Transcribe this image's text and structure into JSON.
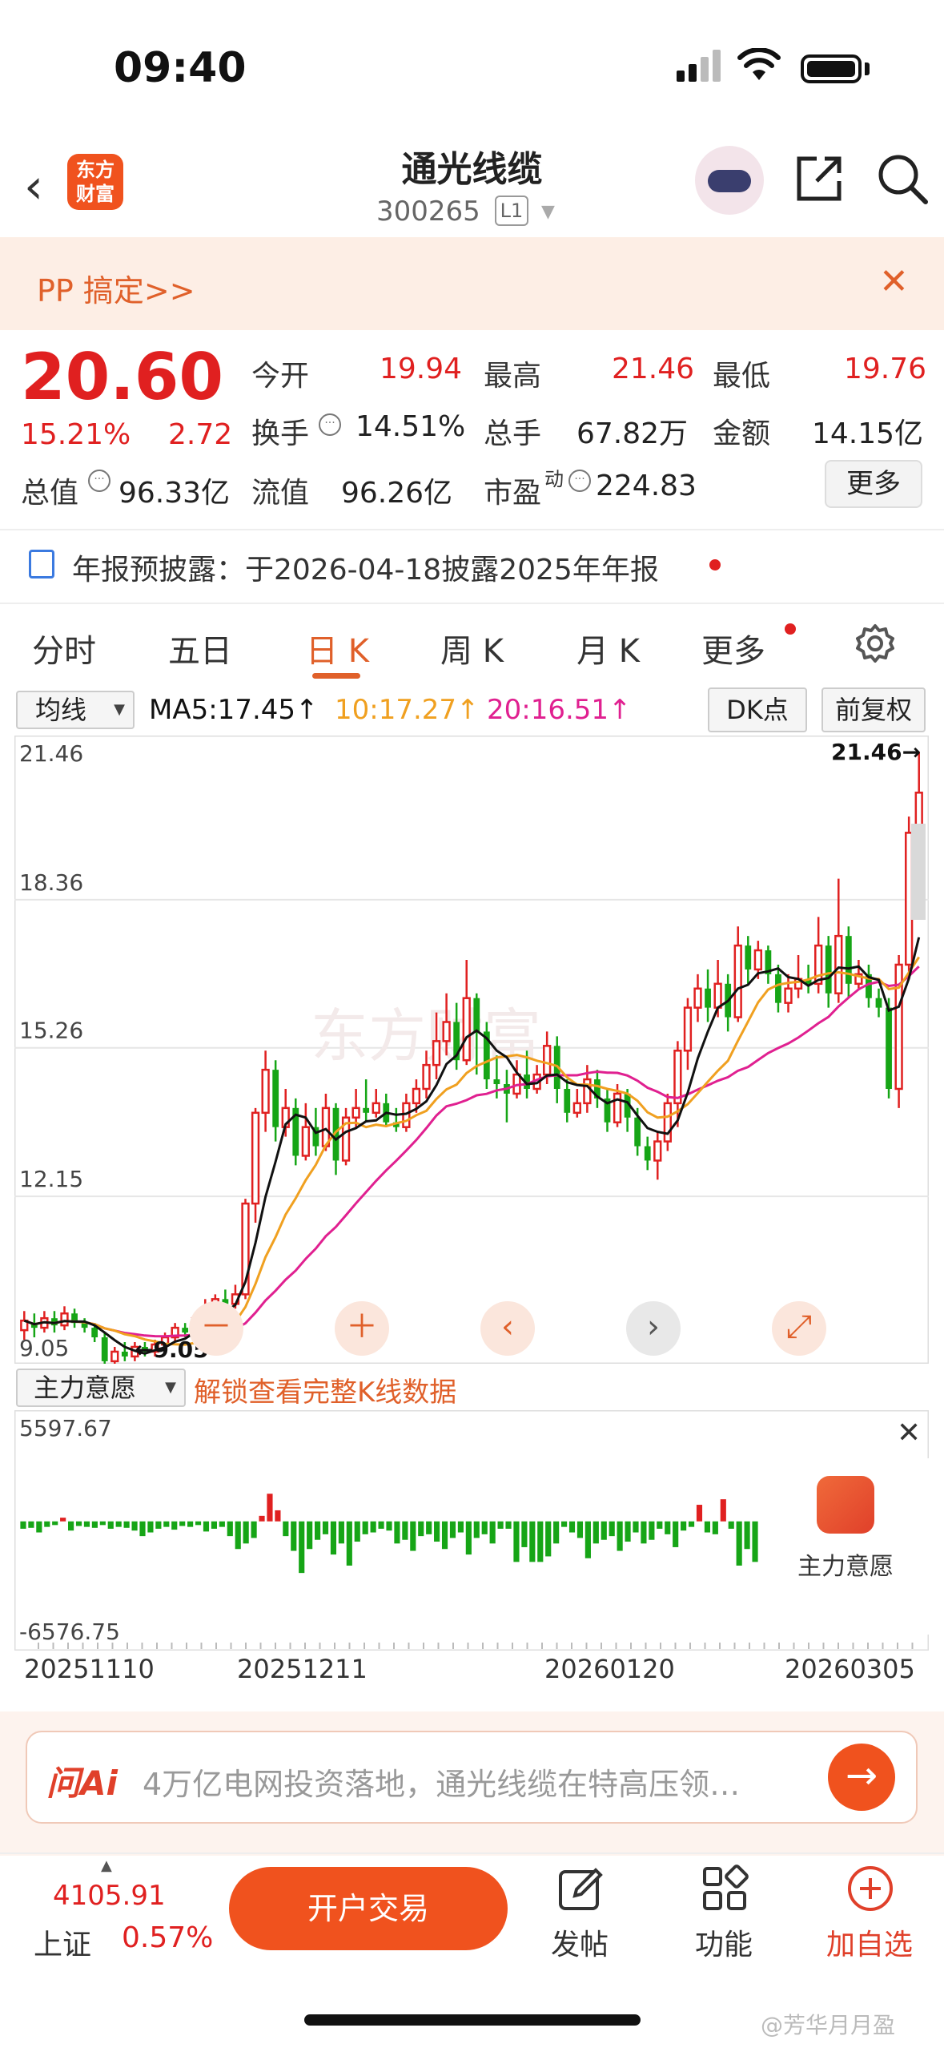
{
  "status_bar": {
    "time": "09:40"
  },
  "header": {
    "title": "通光线缆",
    "code": "300265",
    "level": "L1",
    "logo_text_1": "东方",
    "logo_text_2": "财富"
  },
  "banner": {
    "text": "PP 搞定>>"
  },
  "quote": {
    "price": "20.60",
    "change_pct": "15.21%",
    "change": "2.72",
    "open_label": "今开",
    "open": "19.94",
    "high_label": "最高",
    "high": "21.46",
    "low_label": "最低",
    "low": "19.76",
    "turnover_label": "换手",
    "turnover": "14.51%",
    "volume_label": "总手",
    "volume": "67.82万",
    "amount_label": "金额",
    "amount": "14.15亿",
    "mktcap_label": "总值",
    "mktcap": "96.33亿",
    "float_label": "流值",
    "float": "96.26亿",
    "pe_label": "市盈",
    "pe_sup": "动",
    "pe": "224.83",
    "more": "更多"
  },
  "notice": {
    "text": "年报预披露：于2026-04-18披露2025年年报"
  },
  "tabs": [
    {
      "label": "分时"
    },
    {
      "label": "五日"
    },
    {
      "label": "日 K"
    },
    {
      "label": "周 K"
    },
    {
      "label": "月 K"
    },
    {
      "label": "更多"
    }
  ],
  "ma_bar": {
    "select": "均线",
    "ma5": "MA5:17.45↑",
    "ma10": "10:17.27↑",
    "ma20": "20:16.51↑",
    "dk": "DK点",
    "adjust": "前复权"
  },
  "chart_data": [
    {
      "type": "candlestick",
      "y_ticks": [
        "21.46",
        "18.36",
        "15.26",
        "12.15",
        "9.05"
      ],
      "ylim": [
        9.05,
        21.46
      ],
      "high_annotation": "21.46→",
      "low_annotation": "←9.05",
      "watermark": "东方财富",
      "colors": {
        "up": "#e02020",
        "down": "#16a516",
        "ma5": "#111111",
        "ma10": "#f0a020",
        "ma20": "#e02090"
      },
      "candles": [
        [
          9.35,
          9.55,
          9.15,
          9.75
        ],
        [
          9.5,
          9.4,
          9.2,
          9.7
        ],
        [
          9.4,
          9.6,
          9.3,
          9.75
        ],
        [
          9.6,
          9.45,
          9.3,
          9.75
        ],
        [
          9.45,
          9.7,
          9.35,
          9.85
        ],
        [
          9.7,
          9.5,
          9.4,
          9.8
        ],
        [
          9.5,
          9.4,
          9.3,
          9.6
        ],
        [
          9.4,
          9.2,
          9.1,
          9.5
        ],
        [
          9.2,
          8.7,
          8.6,
          9.3
        ],
        [
          8.7,
          8.9,
          8.6,
          9.0
        ],
        [
          8.9,
          8.8,
          8.7,
          9.1
        ],
        [
          8.8,
          9.0,
          8.7,
          9.1
        ],
        [
          9.0,
          8.9,
          8.8,
          9.1
        ],
        [
          8.9,
          9.05,
          8.8,
          9.15
        ],
        [
          9.05,
          9.2,
          9.0,
          9.3
        ],
        [
          9.2,
          9.4,
          9.1,
          9.5
        ],
        [
          9.4,
          9.3,
          9.2,
          9.5
        ],
        [
          9.3,
          9.6,
          9.2,
          9.7
        ],
        [
          9.6,
          9.8,
          9.5,
          10.0
        ],
        [
          9.8,
          10.0,
          9.7,
          10.1
        ],
        [
          10.0,
          9.9,
          9.8,
          10.2
        ],
        [
          9.9,
          10.1,
          9.8,
          10.3
        ],
        [
          10.1,
          12.0,
          10.0,
          12.1
        ],
        [
          12.0,
          13.9,
          11.6,
          14.0
        ],
        [
          13.9,
          14.8,
          13.5,
          15.2
        ],
        [
          14.8,
          13.6,
          13.3,
          15.0
        ],
        [
          13.6,
          14.0,
          13.4,
          14.4
        ],
        [
          14.0,
          13.0,
          12.8,
          14.2
        ],
        [
          13.0,
          13.6,
          12.9,
          14.1
        ],
        [
          13.6,
          13.2,
          13.0,
          14.0
        ],
        [
          13.2,
          14.0,
          13.1,
          14.3
        ],
        [
          14.0,
          12.9,
          12.6,
          14.1
        ],
        [
          12.9,
          13.8,
          12.8,
          14.0
        ],
        [
          13.8,
          14.0,
          13.6,
          14.4
        ],
        [
          14.0,
          13.9,
          13.7,
          14.6
        ],
        [
          13.9,
          14.1,
          13.8,
          14.4
        ],
        [
          14.1,
          13.7,
          13.6,
          14.3
        ],
        [
          13.7,
          13.6,
          13.5,
          14.0
        ],
        [
          13.6,
          14.1,
          13.5,
          14.3
        ],
        [
          14.1,
          14.4,
          13.9,
          14.6
        ],
        [
          14.4,
          14.9,
          14.2,
          15.2
        ],
        [
          14.9,
          15.4,
          14.6,
          16.0
        ],
        [
          15.4,
          15.8,
          15.1,
          16.4
        ],
        [
          15.8,
          15.0,
          14.8,
          16.2
        ],
        [
          15.0,
          16.3,
          14.9,
          17.1
        ],
        [
          16.3,
          15.6,
          14.7,
          16.4
        ],
        [
          15.6,
          14.6,
          14.4,
          15.8
        ],
        [
          14.6,
          14.5,
          14.2,
          15.1
        ],
        [
          14.5,
          14.3,
          13.7,
          14.8
        ],
        [
          14.3,
          14.7,
          14.2,
          15.0
        ],
        [
          14.7,
          14.4,
          14.2,
          15.2
        ],
        [
          14.4,
          14.7,
          14.3,
          14.9
        ],
        [
          14.7,
          15.3,
          14.5,
          15.6
        ],
        [
          15.3,
          14.4,
          14.1,
          15.5
        ],
        [
          14.4,
          13.9,
          13.7,
          14.6
        ],
        [
          13.9,
          14.1,
          13.8,
          14.4
        ],
        [
          14.1,
          14.6,
          13.9,
          14.9
        ],
        [
          14.6,
          14.2,
          14.0,
          14.8
        ],
        [
          14.2,
          13.7,
          13.5,
          14.4
        ],
        [
          13.7,
          14.3,
          13.6,
          14.5
        ],
        [
          14.3,
          13.8,
          13.5,
          14.4
        ],
        [
          13.8,
          13.2,
          13.0,
          14.0
        ],
        [
          13.2,
          12.9,
          12.7,
          13.4
        ],
        [
          12.9,
          13.3,
          12.5,
          13.5
        ],
        [
          13.3,
          14.1,
          13.1,
          14.3
        ],
        [
          14.1,
          15.2,
          13.6,
          15.4
        ],
        [
          15.2,
          16.1,
          14.8,
          16.3
        ],
        [
          16.1,
          16.5,
          15.8,
          16.8
        ],
        [
          16.5,
          16.1,
          15.8,
          16.9
        ],
        [
          16.1,
          16.6,
          15.9,
          17.1
        ],
        [
          16.6,
          15.9,
          15.6,
          16.8
        ],
        [
          15.9,
          17.4,
          15.8,
          17.8
        ],
        [
          17.4,
          16.9,
          16.6,
          17.6
        ],
        [
          16.9,
          17.3,
          16.7,
          17.5
        ],
        [
          17.3,
          16.8,
          16.6,
          17.4
        ],
        [
          16.8,
          16.2,
          16.0,
          17.0
        ],
        [
          16.2,
          16.5,
          16.0,
          16.8
        ],
        [
          16.5,
          16.7,
          16.3,
          17.2
        ],
        [
          16.7,
          16.6,
          16.4,
          17.0
        ],
        [
          16.6,
          17.4,
          16.4,
          18.0
        ],
        [
          17.4,
          16.4,
          16.1,
          17.6
        ],
        [
          16.4,
          17.6,
          16.2,
          18.8
        ],
        [
          17.6,
          16.6,
          16.3,
          17.8
        ],
        [
          16.6,
          16.8,
          16.5,
          17.1
        ],
        [
          16.8,
          16.3,
          16.1,
          17.0
        ],
        [
          16.3,
          16.1,
          15.9,
          16.5
        ],
        [
          16.1,
          14.4,
          14.2,
          16.3
        ],
        [
          14.4,
          17.0,
          14.0,
          17.2
        ],
        [
          17.0,
          19.76,
          16.8,
          20.1
        ],
        [
          19.76,
          20.6,
          19.76,
          21.46
        ]
      ]
    },
    {
      "type": "bar",
      "title": "主力意愿",
      "y_ticks": [
        "5597.67",
        "-6576.75"
      ],
      "ylim": [
        -6576.75,
        5597.67
      ],
      "x_ticks": [
        "20251110",
        "20251211",
        "20260120",
        "20260305"
      ],
      "colors": {
        "positive": "#e02020",
        "negative": "#16a516"
      },
      "values": [
        -400,
        -350,
        -600,
        -300,
        -200,
        200,
        -500,
        -250,
        -300,
        -350,
        -200,
        -400,
        -300,
        -350,
        -500,
        -800,
        -600,
        -400,
        -300,
        -450,
        -250,
        -300,
        -200,
        -550,
        -400,
        -300,
        -800,
        -1500,
        -1200,
        -900,
        300,
        1500,
        600,
        -800,
        -1600,
        -2800,
        -1500,
        -1000,
        -700,
        -1800,
        -1200,
        -2400,
        -1100,
        -700,
        -600,
        -400,
        -500,
        -1200,
        -1000,
        -1600,
        -800,
        -700,
        -1100,
        -1500,
        -900,
        -600,
        -1800,
        -900,
        -700,
        -1200,
        -400,
        -400,
        -2200,
        -1400,
        -2200,
        -2200,
        -1900,
        -1200,
        -300,
        -600,
        -900,
        -2000,
        -1200,
        -1000,
        -800,
        -1600,
        -1100,
        -600,
        -1200,
        -1000,
        -400,
        -700,
        -1400,
        -500,
        -300,
        900,
        -600,
        -700,
        1200,
        -400,
        -2400,
        -1500,
        -2200
      ]
    }
  ],
  "chart_controls": {
    "zoom_out": "－",
    "zoom_in": "＋",
    "prev": "‹",
    "next": "›",
    "expand": "⤢"
  },
  "flow_bar": {
    "select": "主力意愿",
    "unlock": "解锁查看完整K线数据",
    "panel_label": "主力意愿"
  },
  "ai_bar": {
    "logo": "问Ai",
    "text": "4万亿电网投资落地，通光线缆在特高压领…"
  },
  "bottom_bar": {
    "index_value": "4105.91",
    "index_name": "上证",
    "index_pct": "0.57%",
    "trade_btn": "开户交易",
    "post": "发帖",
    "func": "功能",
    "watch": "加自选"
  },
  "watermark": "@芳华月月盈"
}
